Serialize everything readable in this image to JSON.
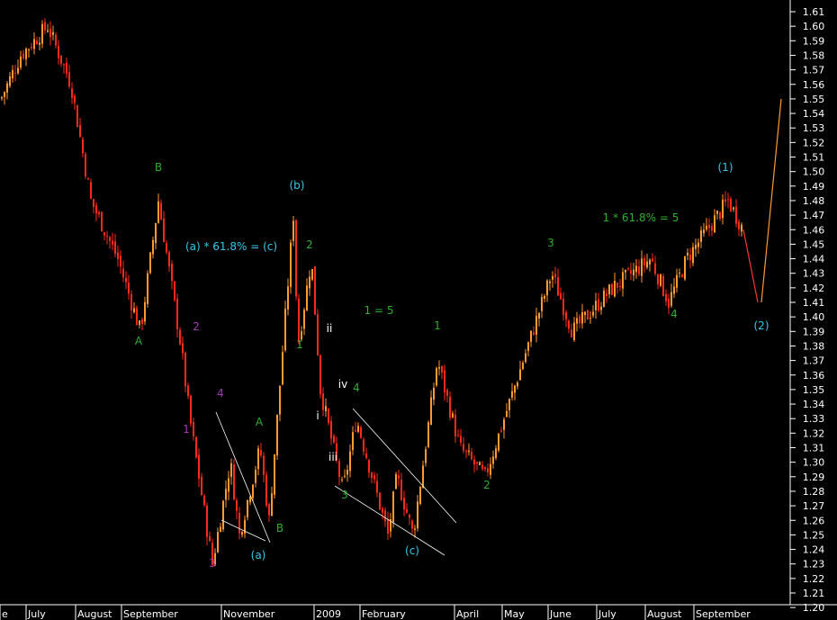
{
  "chart_data": {
    "type": "candlestick",
    "ylim": [
      1.2,
      1.61
    ],
    "y_ticks": [
      "1.61",
      "1.60",
      "1.59",
      "1.58",
      "1.57",
      "1.56",
      "1.55",
      "1.54",
      "1.53",
      "1.52",
      "1.51",
      "1.50",
      "1.49",
      "1.48",
      "1.47",
      "1.46",
      "1.45",
      "1.44",
      "1.43",
      "1.42",
      "1.41",
      "1.40",
      "1.39",
      "1.38",
      "1.37",
      "1.36",
      "1.35",
      "1.34",
      "1.33",
      "1.32",
      "1.31",
      "1.30",
      "1.29",
      "1.28",
      "1.27",
      "1.26",
      "1.25",
      "1.24",
      "1.23",
      "1.22",
      "1.21",
      "1.20"
    ],
    "x_labels": [
      "e",
      "July",
      "August",
      "September",
      "November",
      "2009",
      "February",
      "April",
      "May",
      "June",
      "July",
      "August",
      "September"
    ],
    "waypoints": [
      {
        "x": "Jun 2008",
        "y": 1.55
      },
      {
        "x": "Jul 2008",
        "y": 1.58
      },
      {
        "x": "Jul 2008",
        "y": 1.6
      },
      {
        "x": "Aug 2008",
        "y": 1.56
      },
      {
        "x": "Aug 2008",
        "y": 1.48
      },
      {
        "x": "Sep 2008",
        "y": 1.44
      },
      {
        "x": "Sep 2008",
        "y": 1.39
      },
      {
        "x": "Sep 2008",
        "y": 1.48
      },
      {
        "x": "Oct 2008",
        "y": 1.38
      },
      {
        "x": "Oct 2008",
        "y": 1.33
      },
      {
        "x": "Oct 2008",
        "y": 1.23
      },
      {
        "x": "Nov 2008",
        "y": 1.3
      },
      {
        "x": "Nov 2008",
        "y": 1.25
      },
      {
        "x": "Nov 2008",
        "y": 1.31
      },
      {
        "x": "Nov 2008",
        "y": 1.26
      },
      {
        "x": "Dec 2008",
        "y": 1.47
      },
      {
        "x": "Dec 2008",
        "y": 1.38
      },
      {
        "x": "Dec 2008",
        "y": 1.44
      },
      {
        "x": "Jan 2009",
        "y": 1.35
      },
      {
        "x": "Jan 2009",
        "y": 1.28
      },
      {
        "x": "Jan 2009",
        "y": 1.33
      },
      {
        "x": "Feb 2009",
        "y": 1.25
      },
      {
        "x": "Feb 2009",
        "y": 1.29
      },
      {
        "x": "Mar 2009",
        "y": 1.25
      },
      {
        "x": "Mar 2009",
        "y": 1.37
      },
      {
        "x": "Apr 2009",
        "y": 1.31
      },
      {
        "x": "Apr 2009",
        "y": 1.29
      },
      {
        "x": "May 2009",
        "y": 1.36
      },
      {
        "x": "Jun 2009",
        "y": 1.43
      },
      {
        "x": "Jun 2009",
        "y": 1.39
      },
      {
        "x": "Jul 2009",
        "y": 1.42
      },
      {
        "x": "Aug 2009",
        "y": 1.44
      },
      {
        "x": "Aug 2009",
        "y": 1.41
      },
      {
        "x": "Sep 2009",
        "y": 1.44
      },
      {
        "x": "Sep 2009",
        "y": 1.48
      },
      {
        "x": "Sep 2009",
        "y": 1.46
      }
    ],
    "projection": [
      {
        "from": "(1)",
        "to": "(2)",
        "y_from": 1.46,
        "y_to": 1.41,
        "color": "#ff3333"
      },
      {
        "from": "(2)",
        "to": "",
        "y_from": 1.41,
        "y_to": 1.55,
        "color": "#ff9a33"
      }
    ],
    "trendlines": [
      {
        "name": "channel-a-upper",
        "from": {
          "x": "Oct 2008",
          "y": 1.33
        },
        "to": {
          "x": "Nov 2008",
          "y": 1.24
        }
      },
      {
        "name": "channel-a-lower",
        "from": {
          "x": "Oct 2008",
          "y": 1.25
        },
        "to": {
          "x": "Nov 2008",
          "y": 1.24
        }
      },
      {
        "name": "channel-c-upper",
        "from": {
          "x": "Jan 2009",
          "y": 1.33
        },
        "to": {
          "x": "Mar 2009",
          "y": 1.25
        }
      },
      {
        "name": "channel-c-lower",
        "from": {
          "x": "Jan 2009",
          "y": 1.28
        },
        "to": {
          "x": "Mar 2009",
          "y": 1.23
        }
      }
    ],
    "annotations": [
      {
        "text": "B",
        "color": "#2fae2f",
        "at": {
          "x": "Aug 2008",
          "y": 1.5
        }
      },
      {
        "text": "A",
        "color": "#2fae2f",
        "at": {
          "x": "Sep 2008",
          "y": 1.38
        }
      },
      {
        "text": "2",
        "color": "#a23ab3",
        "at": {
          "x": "Sep 2008",
          "y": 1.39
        }
      },
      {
        "text": "1",
        "color": "#a23ab3",
        "at": {
          "x": "Oct 2008",
          "y": 1.32
        }
      },
      {
        "text": "4",
        "color": "#a23ab3",
        "at": {
          "x": "Oct 2008",
          "y": 1.34
        }
      },
      {
        "text": "3",
        "color": "#a23ab3",
        "at": {
          "x": "Oct 2008",
          "y": 1.23
        }
      },
      {
        "text": "A",
        "color": "#2fae2f",
        "at": {
          "x": "Nov 2008",
          "y": 1.32
        }
      },
      {
        "text": "B",
        "color": "#2fae2f",
        "at": {
          "x": "Nov 2008",
          "y": 1.25
        }
      },
      {
        "text": "(a)",
        "color": "#35c8e6",
        "at": {
          "x": "Nov 2008",
          "y": 1.23
        }
      },
      {
        "text": "(a) * 61.8% = (c)",
        "color": "#35c8e6",
        "at": {
          "x": "Oct 2008",
          "y": 1.44
        }
      },
      {
        "text": "(b)",
        "color": "#35c8e6",
        "at": {
          "x": "Dec 2008",
          "y": 1.48
        }
      },
      {
        "text": "2",
        "color": "#2fae2f",
        "at": {
          "x": "Dec 2008",
          "y": 1.44
        }
      },
      {
        "text": "1",
        "color": "#2fae2f",
        "at": {
          "x": "Dec 2008",
          "y": 1.38
        }
      },
      {
        "text": "ii",
        "color": "#ffffff",
        "at": {
          "x": "Dec 2008",
          "y": 1.39
        }
      },
      {
        "text": "i",
        "color": "#ffffff",
        "at": {
          "x": "Jan 2009",
          "y": 1.32
        }
      },
      {
        "text": "iv",
        "color": "#ffffff",
        "at": {
          "x": "Jan 2009",
          "y": 1.34
        }
      },
      {
        "text": "iii",
        "color": "#ffffff",
        "at": {
          "x": "Jan 2009",
          "y": 1.3
        }
      },
      {
        "text": "4",
        "color": "#2fae2f",
        "at": {
          "x": "Jan 2009",
          "y": 1.34
        }
      },
      {
        "text": "3",
        "color": "#2fae2f",
        "at": {
          "x": "Jan 2009",
          "y": 1.27
        }
      },
      {
        "text": "1 = 5",
        "color": "#2fae2f",
        "at": {
          "x": "Feb 2009",
          "y": 1.4
        }
      },
      {
        "text": "(c)",
        "color": "#35c8e6",
        "at": {
          "x": "Feb 2009",
          "y": 1.23
        }
      },
      {
        "text": "1",
        "color": "#2fae2f",
        "at": {
          "x": "Mar 2009",
          "y": 1.39
        }
      },
      {
        "text": "2",
        "color": "#2fae2f",
        "at": {
          "x": "Apr 2009",
          "y": 1.28
        }
      },
      {
        "text": "3",
        "color": "#2fae2f",
        "at": {
          "x": "Jun 2009",
          "y": 1.44
        }
      },
      {
        "text": "1 * 61.8% = 5",
        "color": "#2fae2f",
        "at": {
          "x": "Jul 2009",
          "y": 1.46
        }
      },
      {
        "text": "4",
        "color": "#2fae2f",
        "at": {
          "x": "Aug 2009",
          "y": 1.4
        }
      },
      {
        "text": "(1)",
        "color": "#35c8e6",
        "at": {
          "x": "Sep 2009",
          "y": 1.5
        }
      },
      {
        "text": "(2)",
        "color": "#35c8e6",
        "at": {
          "x": "Sep 2009",
          "y": 1.39
        }
      }
    ],
    "colors": {
      "background": "#000000",
      "candle_up": "#ff9a33",
      "candle_down": "#ff2a1a",
      "trendline": "#ffffff",
      "axis_text": "#ffffff",
      "green_labels": "#2fae2f",
      "purple_labels": "#a23ab3",
      "cyan_labels": "#35c8e6"
    }
  }
}
